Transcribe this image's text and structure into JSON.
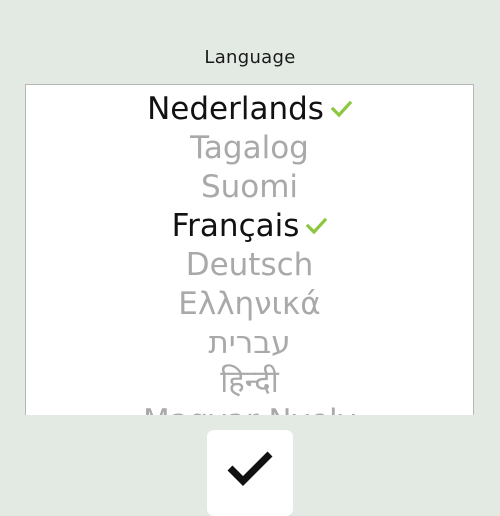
{
  "screen": {
    "title": "Language"
  },
  "languages": [
    {
      "label": "Nederlands",
      "selected": true
    },
    {
      "label": "Tagalog",
      "selected": false
    },
    {
      "label": "Suomi",
      "selected": false
    },
    {
      "label": "Français",
      "selected": true
    },
    {
      "label": "Deutsch",
      "selected": false
    },
    {
      "label": "Ελληνικά",
      "selected": false
    },
    {
      "label": "עברית",
      "selected": false
    },
    {
      "label": "हिन्दी",
      "selected": false
    },
    {
      "label": "Magyar Nyelv",
      "selected": false
    }
  ],
  "colors": {
    "background": "#e3e9e3",
    "selected_text": "#111111",
    "unselected_text": "#a9a9a9",
    "check_accent": "#8dc63f",
    "confirm_icon": "#111111"
  },
  "icons": {
    "selected_marker": "check-icon",
    "confirm": "checkmark-icon"
  }
}
